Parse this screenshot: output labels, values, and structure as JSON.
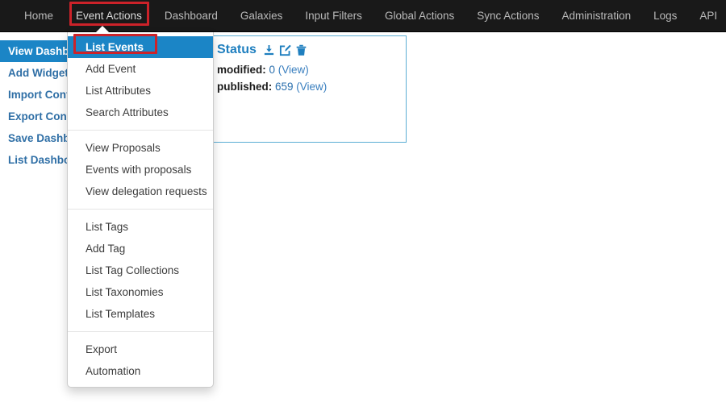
{
  "navbar": {
    "items": [
      {
        "label": "Home",
        "active": false
      },
      {
        "label": "Event Actions",
        "active": true
      },
      {
        "label": "Dashboard",
        "active": false
      },
      {
        "label": "Galaxies",
        "active": false
      },
      {
        "label": "Input Filters",
        "active": false
      },
      {
        "label": "Global Actions",
        "active": false
      },
      {
        "label": "Sync Actions",
        "active": false
      },
      {
        "label": "Administration",
        "active": false
      },
      {
        "label": "Logs",
        "active": false
      },
      {
        "label": "API",
        "active": false
      }
    ]
  },
  "sidebar": {
    "items": [
      {
        "label": "View Dashboard",
        "selected": true
      },
      {
        "label": "Add Widget",
        "selected": false
      },
      {
        "label": "Import Config",
        "selected": false
      },
      {
        "label": "Export Config",
        "selected": false
      },
      {
        "label": "Save Dashboard",
        "selected": false
      },
      {
        "label": "List Dashboards",
        "selected": false
      }
    ]
  },
  "dropdown": {
    "groups": [
      {
        "items": [
          {
            "label": "List Events",
            "highlight": true
          },
          {
            "label": "Add Event",
            "highlight": false
          },
          {
            "label": "List Attributes",
            "highlight": false
          },
          {
            "label": "Search Attributes",
            "highlight": false
          }
        ]
      },
      {
        "items": [
          {
            "label": "View Proposals",
            "highlight": false
          },
          {
            "label": "Events with proposals",
            "highlight": false
          },
          {
            "label": "View delegation requests",
            "highlight": false
          }
        ]
      },
      {
        "items": [
          {
            "label": "List Tags",
            "highlight": false
          },
          {
            "label": "Add Tag",
            "highlight": false
          },
          {
            "label": "List Tag Collections",
            "highlight": false
          },
          {
            "label": "List Taxonomies",
            "highlight": false
          },
          {
            "label": "List Templates",
            "highlight": false
          }
        ]
      },
      {
        "items": [
          {
            "label": "Export",
            "highlight": false
          },
          {
            "label": "Automation",
            "highlight": false
          }
        ]
      }
    ]
  },
  "panel": {
    "title": "Status",
    "icons": [
      {
        "name": "download-icon"
      },
      {
        "name": "edit-icon"
      },
      {
        "name": "trash-icon"
      }
    ],
    "stats": [
      {
        "label": "modified",
        "separator": ": ",
        "value": "0",
        "link": "(View)"
      },
      {
        "label": "published",
        "separator": ": ",
        "value": "659",
        "link": "(View)"
      }
    ]
  },
  "annotations": {
    "nav_target": "Event Actions",
    "menu_target": "List Events",
    "color": "#cc2229"
  },
  "colors": {
    "navbar_bg": "#191919",
    "accent_blue": "#1b85c6",
    "link_blue": "#2f6fa6",
    "annotation_red": "#cc2229"
  }
}
